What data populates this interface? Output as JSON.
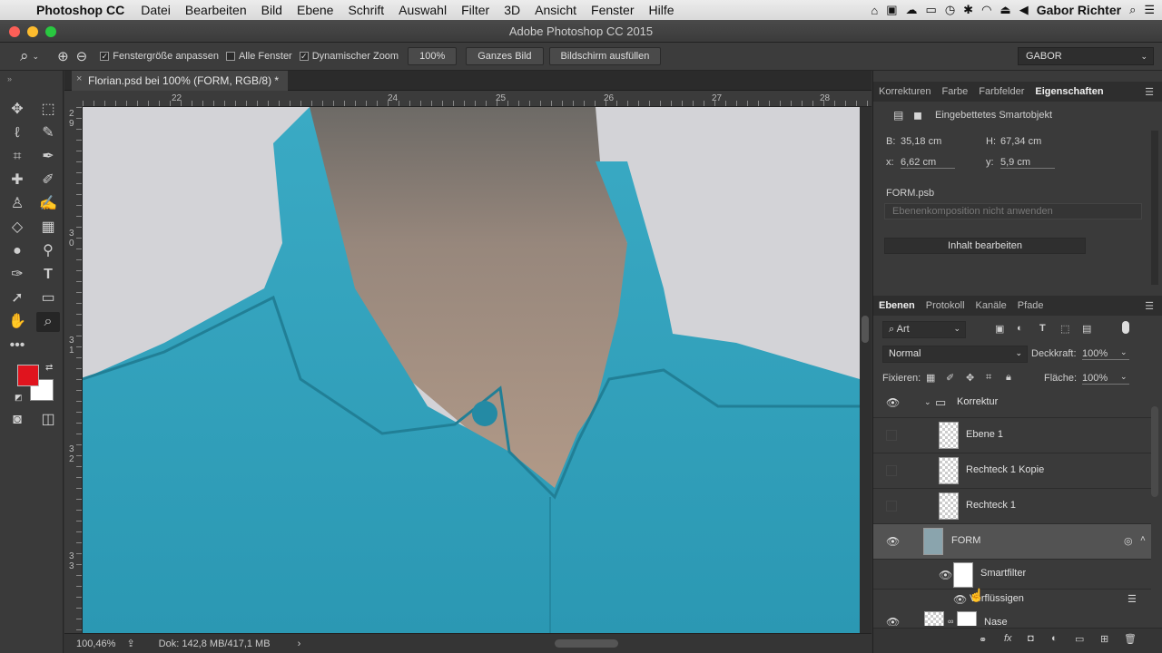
{
  "menubar": {
    "app_name": "Photoshop CC",
    "items": [
      "Datei",
      "Bearbeiten",
      "Bild",
      "Ebene",
      "Schrift",
      "Auswahl",
      "Filter",
      "3D",
      "Ansicht",
      "Fenster",
      "Hilfe"
    ],
    "user": "Gabor Richter"
  },
  "window": {
    "title": "Adobe Photoshop CC 2015"
  },
  "options": {
    "fit_window_label": "Fenstergröße anpassen",
    "all_windows_label": "Alle Fenster",
    "dynamic_zoom_label": "Dynamischer Zoom",
    "zoom_value": "100%",
    "fit_screen_button": "Ganzes Bild",
    "fill_screen_button": "Bildschirm ausfüllen",
    "workspace": "GABOR"
  },
  "document": {
    "tab_title": "Florian.psd bei 100% (FORM, RGB/8) *",
    "ruler_h": [
      "22",
      "24",
      "25",
      "26",
      "27",
      "28"
    ],
    "ruler_v": [
      "2\n9",
      "3\n0",
      "3\n1",
      "3\n2",
      "3\n3"
    ]
  },
  "status": {
    "zoom": "100,46%",
    "doc": "Dok: 142,8 MB/417,1 MB"
  },
  "properties_tabs": [
    "Korrekturen",
    "Farbe",
    "Farbfelder",
    "Eigenschaften"
  ],
  "properties": {
    "title": "Eingebettetes Smartobjekt",
    "w_label": "B:",
    "w_value": "35,18 cm",
    "h_label": "H:",
    "h_value": "67,34 cm",
    "x_label": "x:",
    "x_value": "6,62 cm",
    "y_label": "y:",
    "y_value": "5,9 cm",
    "file": "FORM.psb",
    "comp_placeholder": "Ebenenkomposition nicht anwenden",
    "edit_button": "Inhalt bearbeiten"
  },
  "layers_tabs": [
    "Ebenen",
    "Protokoll",
    "Kanäle",
    "Pfade"
  ],
  "layers_panel": {
    "filter_kind": "Art",
    "blend_mode": "Normal",
    "opacity_label": "Deckkraft:",
    "opacity_value": "100%",
    "lock_label": "Fixieren:",
    "fill_label": "Fläche:",
    "fill_value": "100%"
  },
  "layers": [
    {
      "name": "Korrektur"
    },
    {
      "name": "Ebene 1"
    },
    {
      "name": "Rechteck 1 Kopie"
    },
    {
      "name": "Rechteck 1"
    },
    {
      "name": "FORM"
    },
    {
      "name": "Smartfilter"
    },
    {
      "name": "Verflüssigen"
    },
    {
      "name": "Nase"
    }
  ],
  "colors": {
    "foreground": "#e0141e",
    "background": "#ffffff",
    "shirt": "#2fa3be"
  }
}
